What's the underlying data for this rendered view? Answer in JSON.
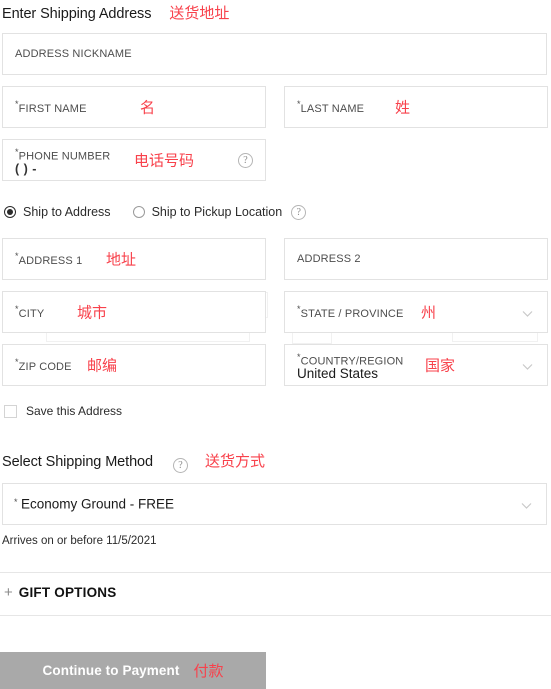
{
  "shipping_section": {
    "title": "Enter Shipping Address",
    "title_cn": "送货地址"
  },
  "fields": {
    "address_nickname": {
      "label": "ADDRESS NICKNAME"
    },
    "first_name": {
      "label": "FIRST NAME",
      "required_mark": "*",
      "cn": "名"
    },
    "last_name": {
      "label": "LAST NAME",
      "required_mark": "*",
      "cn": "姓"
    },
    "phone_number": {
      "label": "PHONE NUMBER",
      "required_mark": "*",
      "mask": "( ) -",
      "cn": "电话号码",
      "help_icon": "question-circle-icon"
    },
    "address_1": {
      "label": "ADDRESS 1",
      "required_mark": "*",
      "cn": "地址"
    },
    "address_2": {
      "label": "ADDRESS 2"
    },
    "city": {
      "label": "CITY",
      "required_mark": "*",
      "cn": "城市"
    },
    "state_province": {
      "label": "STATE / PROVINCE",
      "required_mark": "*",
      "cn": "州",
      "chevron": "chevron-down-icon"
    },
    "zip_code": {
      "label": "ZIP CODE",
      "required_mark": "*",
      "cn": "邮编"
    },
    "country_region": {
      "label": "COUNTRY/REGION",
      "required_mark": "*",
      "value": "United States",
      "cn": "国家",
      "chevron": "chevron-down-icon"
    }
  },
  "ship_options": {
    "address_option": "Ship to Address",
    "pickup_option": "Ship to Pickup Location",
    "selected": "address",
    "help_icon": "question-circle-icon"
  },
  "save_address": {
    "label": "Save this Address",
    "checked": false
  },
  "shipping_method": {
    "title": "Select Shipping Method",
    "title_cn": "送货方式",
    "help_icon": "question-circle-icon",
    "selected": "Economy Ground - FREE",
    "required_mark": "*",
    "chevron": "chevron-down-icon",
    "arrival_note": "Arrives on or before 11/5/2021"
  },
  "gift_options": {
    "expand_icon": "+",
    "label": "GIFT OPTIONS"
  },
  "cta": {
    "label": "Continue to Payment",
    "label_cn": "付款"
  },
  "colors": {
    "annotation_red": "#f8414b",
    "button_gray": "#a9a9a9",
    "field_border": "#e2e2e2",
    "divider": "#e6e6e6"
  },
  "ghost_artifacts": {
    "state_echo": "STATE / PROVINCE"
  }
}
